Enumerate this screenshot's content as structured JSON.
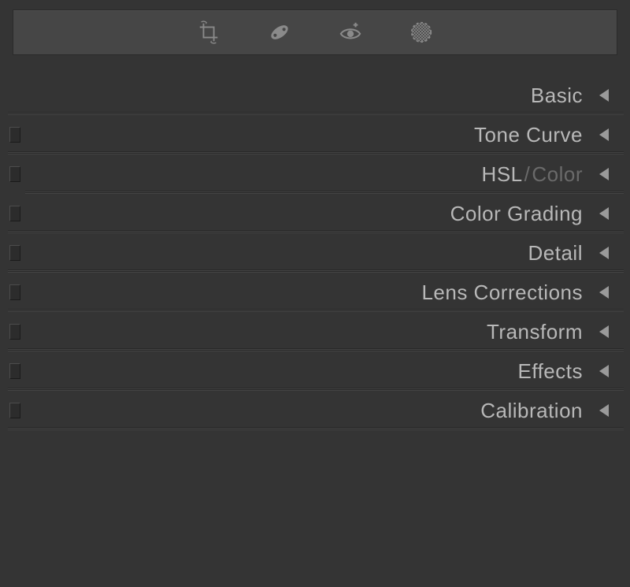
{
  "toolbar": {
    "tools": [
      {
        "name": "crop"
      },
      {
        "name": "spot-removal"
      },
      {
        "name": "red-eye"
      },
      {
        "name": "masking"
      }
    ]
  },
  "panels": [
    {
      "label": "Basic",
      "secondary": "",
      "has_toggle": false
    },
    {
      "label": "Tone Curve",
      "secondary": "",
      "has_toggle": true
    },
    {
      "label": "HSL",
      "secondary": "Color",
      "has_toggle": true
    },
    {
      "label": "Color Grading",
      "secondary": "",
      "has_toggle": true
    },
    {
      "label": "Detail",
      "secondary": "",
      "has_toggle": true
    },
    {
      "label": "Lens Corrections",
      "secondary": "",
      "has_toggle": true
    },
    {
      "label": "Transform",
      "secondary": "",
      "has_toggle": true
    },
    {
      "label": "Effects",
      "secondary": "",
      "has_toggle": true
    },
    {
      "label": "Calibration",
      "secondary": "",
      "has_toggle": true
    }
  ]
}
